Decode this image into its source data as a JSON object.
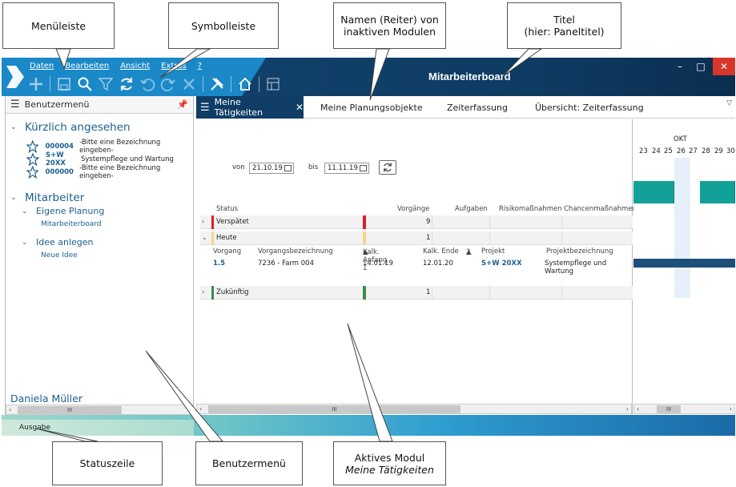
{
  "callouts": {
    "menubar": "Menüleiste",
    "toolbar": "Symbolleiste",
    "tabs_line1": "Namen (Reiter) von",
    "tabs_line2": "inaktiven Modulen",
    "title_line1": "Titel",
    "title_line2": "(hier: Paneltitel)",
    "statusbar": "Statuszeile",
    "usermenu": "Benutzermenü",
    "active_line1": "Aktives Modul",
    "active_line2": "Meine Tätigkeiten"
  },
  "window": {
    "title": "Mitarbeiterboard",
    "menu": [
      "Daten",
      "Bearbeiten",
      "Ansicht",
      "Extras",
      "?"
    ],
    "toolbar_icons": [
      "add-icon",
      "save-icon",
      "search-icon",
      "filter-icon",
      "refresh-icon",
      "undo-icon",
      "redo-icon",
      "delete-icon",
      "tools-icon",
      "home-icon",
      "board-icon"
    ],
    "controls": {
      "minimize": "–",
      "maximize": "□",
      "close": "✕"
    },
    "colors": {
      "accent": "#1b88c8",
      "dark": "#0f3d66",
      "teal": "#12a198",
      "red": "#d9202a",
      "yellow": "#f4d58d",
      "green": "#3a8a4e"
    }
  },
  "usermenu": {
    "header": "Benutzermenü",
    "recent_title": "Kürzlich angesehen",
    "recent": [
      {
        "id": "000004",
        "text": "-Bitte eine Bezeichnung eingeben-"
      },
      {
        "id": "S+W 20XX",
        "text": "Systempflege und Wartung"
      },
      {
        "id": "000000",
        "text": "-Bitte eine Bezeichnung eingeben-"
      }
    ],
    "staff_title": "Mitarbeiter",
    "own_planning": "Eigene Planung",
    "board": "Mitarbeiterboard",
    "idea_group": "Idee anlegen",
    "new_idea": "Neue Idee",
    "user": "Daniela Müller",
    "scroll": "III"
  },
  "tabs": {
    "active": "Meine Tätigkeiten",
    "others": [
      "Meine Planungsobjekte",
      "Zeiterfassung",
      "Übersicht: Zeiterfassung"
    ]
  },
  "filter": {
    "from_label": "von",
    "from": "21.10.19",
    "to_label": "bis",
    "to": "11.11.19"
  },
  "grid": {
    "headers": {
      "status": "Status",
      "count": "Vorgänge",
      "tasks": "Aufgaben",
      "risks": "Risikomaßnahmen",
      "chances": "Chancenmaßnahmen"
    },
    "groups": [
      {
        "name": "Verspätet",
        "count": "9"
      },
      {
        "name": "Heute",
        "count": "1"
      },
      {
        "name": "Zukünftig",
        "count": "1"
      }
    ],
    "detail_headers": {
      "proc": "Vorgang",
      "desc": "Vorgangsbezeichnung",
      "start": "Kalk. Anfang 1",
      "end": "Kalk. Ende",
      "sort2": "2",
      "project": "Projekt",
      "project_desc": "Projektbezeichnung"
    },
    "detail_row": {
      "proc": "1.5",
      "desc": "7236 - Farm 004",
      "start": "14.01.19",
      "end": "12.01.20",
      "project": "S+W 20XX",
      "project_desc": "Systempflege und Wartung"
    },
    "scroll": "III"
  },
  "gantt": {
    "month": "OKT",
    "days": [
      "23",
      "24",
      "25",
      "26",
      "27",
      "28",
      "29",
      "30"
    ],
    "scroll": "III"
  },
  "statusbar": "Ausgabe"
}
